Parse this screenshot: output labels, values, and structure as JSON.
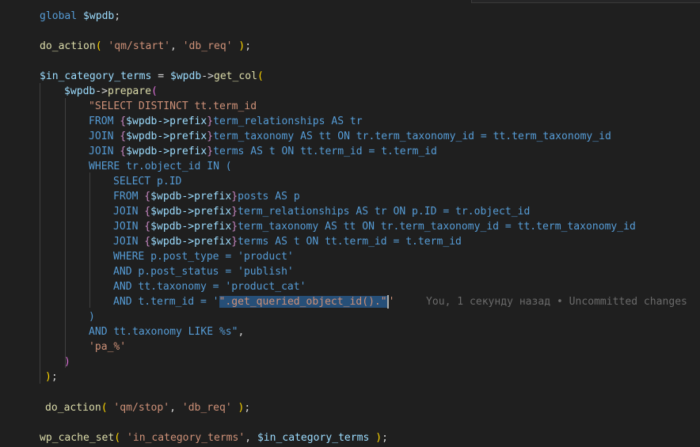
{
  "code": {
    "l1_kw": "global",
    "l1_var": "$wpdb",
    "l1_end": ";",
    "l2_fn": "do_action",
    "l2_open": "(",
    "l2_sp": " ",
    "l2_s1": "'qm/start'",
    "l2_comma": ", ",
    "l2_s2": "'db_req'",
    "l2_close": ")",
    "l2_end": ";",
    "l3_var": "$in_category_terms",
    "l3_eq": " = ",
    "l3_var2": "$wpdb",
    "l3_arrow": "->",
    "l3_fn": "get_col",
    "l3_open": "(",
    "l4_var": "$wpdb",
    "l4_arrow": "->",
    "l4_fn": "prepare",
    "l4_open": "(",
    "q1": "\"SELECT DISTINCT tt.term_id",
    "q2_kw": "FROM ",
    "q2_b1": "{",
    "q2_var": "$wpdb->prefix",
    "q2_b2": "}",
    "q2_rest": "term_relationships AS tr",
    "q3_kw": "JOIN ",
    "q3_b1": "{",
    "q3_var": "$wpdb->prefix",
    "q3_b2": "}",
    "q3_rest": "term_taxonomy AS tt ON tr.term_taxonomy_id = tt.term_taxonomy_id",
    "q4_kw": "JOIN ",
    "q4_b1": "{",
    "q4_var": "$wpdb->prefix",
    "q4_b2": "}",
    "q4_rest": "terms AS t ON tt.term_id = t.term_id",
    "q5": "WHERE tr.object_id IN (",
    "q6": "SELECT p.ID",
    "q7_kw": "FROM ",
    "q7_b1": "{",
    "q7_var": "$wpdb->prefix",
    "q7_b2": "}",
    "q7_rest": "posts AS p",
    "q8_kw": "JOIN ",
    "q8_b1": "{",
    "q8_var": "$wpdb->prefix",
    "q8_b2": "}",
    "q8_rest": "term_relationships AS tr ON p.ID = tr.object_id",
    "q9_kw": "JOIN ",
    "q9_b1": "{",
    "q9_var": "$wpdb->prefix",
    "q9_b2": "}",
    "q9_rest": "term_taxonomy AS tt ON tr.term_taxonomy_id = tt.term_taxonomy_id",
    "q10_kw": "JOIN ",
    "q10_b1": "{",
    "q10_var": "$wpdb->prefix",
    "q10_b2": "}",
    "q10_rest": "terms AS t ON tt.term_id = t.term_id",
    "q11": "WHERE p.post_type = 'product'",
    "q12": "AND p.post_status = 'publish'",
    "q13": "AND tt.taxonomy = 'product_cat'",
    "q14_pre": "AND t.term_id = '",
    "q14_sel": "\".get_queried_object_id().\"",
    "q14_post": "'",
    "blame": "You, 1 секунду назад • Uncommitted changes",
    "q15": ")",
    "q16": "AND tt.taxonomy LIKE %s\"",
    "q16_comma": ",",
    "q17_str": "'pa_%'",
    "l18_close": ")",
    "l19_close": ")",
    "l19_end": ";",
    "l20_fn": "do_action",
    "l20_open": "(",
    "l20_sp": " ",
    "l20_s1": "'qm/stop'",
    "l20_comma": ", ",
    "l20_s2": "'db_req'",
    "l20_close": ")",
    "l20_end": ";",
    "l21_fn": "wp_cache_set",
    "l21_open": "(",
    "l21_sp": " ",
    "l21_s1": "'in_category_terms'",
    "l21_comma": ", ",
    "l21_var": "$in_category_terms",
    "l21_close": ")",
    "l21_end": ";"
  },
  "colors": {
    "background": "#1f1f1f",
    "keyword": "#569cd6",
    "function": "#dcdcaa",
    "variable": "#9cdcfe",
    "string": "#ce9178",
    "selection": "#264f78"
  }
}
